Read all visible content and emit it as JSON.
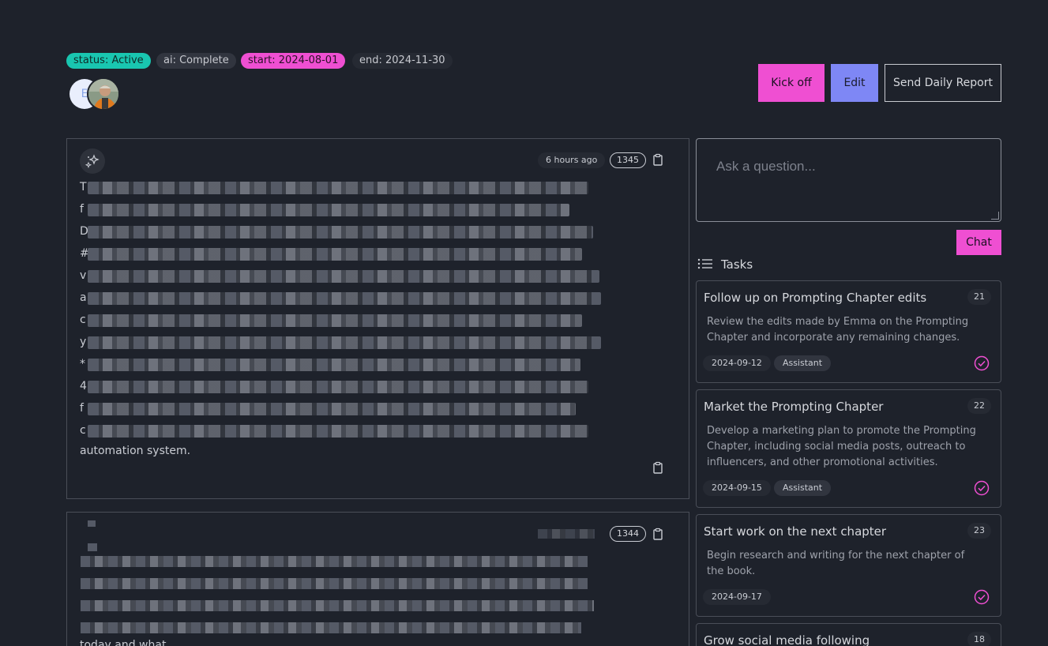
{
  "header": {
    "tags": {
      "status": "status: Active",
      "ai": "ai: Complete",
      "start": "start: 2024-08-01",
      "end": "end: 2024-11-30"
    },
    "avatar_initial": "E",
    "actions": {
      "kick_off": "Kick off",
      "edit": "Edit",
      "send_report": "Send Daily Report"
    }
  },
  "messages": [
    {
      "time": "6 hours ago",
      "id": "1345",
      "first_letters": [
        "T",
        "f",
        "D",
        "#",
        "v",
        "a",
        "c",
        "y",
        "*",
        "4",
        "f",
        "c"
      ],
      "last_line": "automation system."
    },
    {
      "id": "1344",
      "last_line": "today and what"
    }
  ],
  "chat": {
    "placeholder": "Ask a question...",
    "button": "Chat"
  },
  "tasks_header": "Tasks",
  "tasks": [
    {
      "title": "Follow up on Prompting Chapter edits",
      "num": "21",
      "desc": "Review the edits made by Emma on the Prompting Chapter and incorporate any remaining changes.",
      "date": "2024-09-12",
      "role": "Assistant"
    },
    {
      "title": "Market the Prompting Chapter",
      "num": "22",
      "desc": "Develop a marketing plan to promote the Prompting Chapter, including social media posts, outreach to influencers, and other promotional activities.",
      "date": "2024-09-15",
      "role": "Assistant"
    },
    {
      "title": "Start work on the next chapter",
      "num": "23",
      "desc": "Begin research and writing for the next chapter of the book.",
      "date": "2024-09-17",
      "role": ""
    },
    {
      "title": "Grow social media following",
      "num": "18",
      "desc": "",
      "date": "",
      "role": ""
    }
  ],
  "colors": {
    "accent_pink": "#ef4fd2",
    "accent_indigo": "#7e87f5",
    "status_teal": "#19c6b0",
    "background": "#1e222b"
  }
}
